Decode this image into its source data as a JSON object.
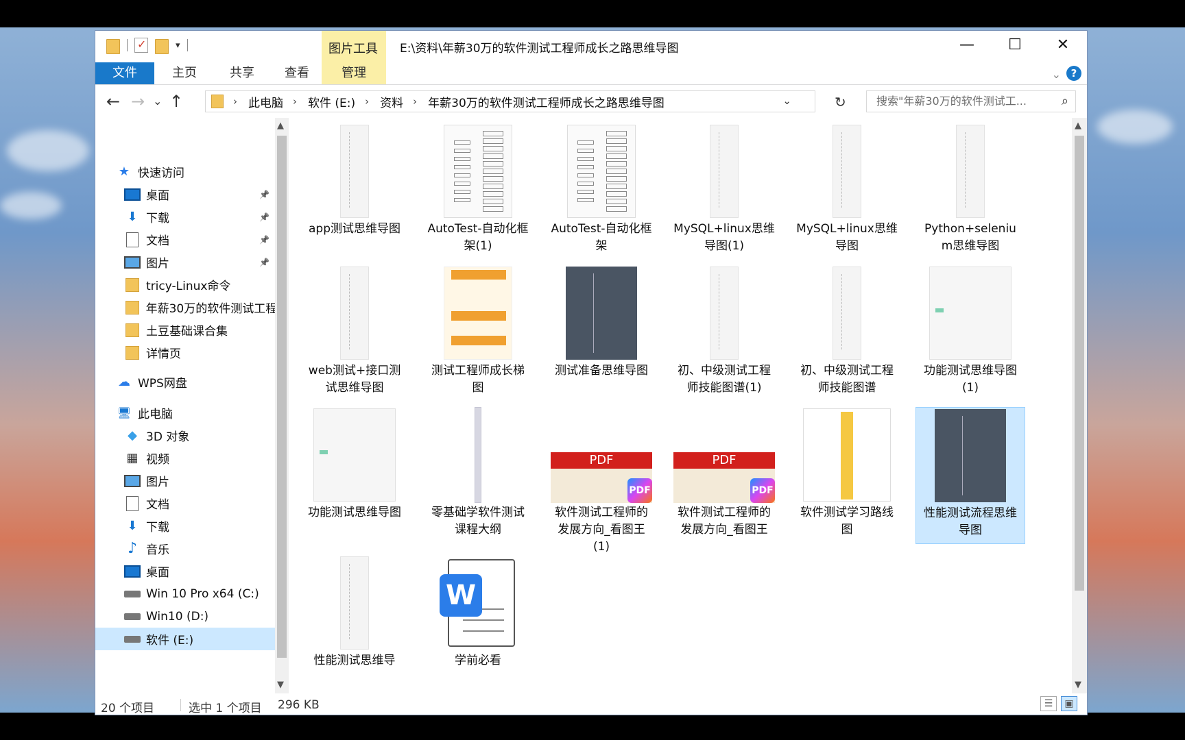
{
  "window": {
    "title": "E:\\资料\\年薪30万的软件测试工程师成长之路思维导图",
    "context_tab_group": "图片工具",
    "controls": {
      "minimize": "—",
      "maximize": "☐",
      "close": "✕"
    }
  },
  "ribbon": {
    "tabs": [
      "文件",
      "主页",
      "共享",
      "查看",
      "管理"
    ],
    "help": "?"
  },
  "nav": {
    "back": "←",
    "forward": "→",
    "recent": "⌄",
    "up": "↑",
    "breadcrumb": [
      "此电脑",
      "软件 (E:)",
      "资料",
      "年薪30万的软件测试工程师成长之路思维导图"
    ],
    "search_placeholder": "搜索\"年薪30万的软件测试工...",
    "refresh": "↻"
  },
  "sidebar": {
    "items": [
      {
        "label": "快速访问",
        "icon": "star-icon",
        "level": 0
      },
      {
        "label": "桌面",
        "icon": "desktop-icon",
        "level": 1,
        "pinned": true
      },
      {
        "label": "下载",
        "icon": "download-icon",
        "level": 1,
        "pinned": true
      },
      {
        "label": "文档",
        "icon": "document-icon",
        "level": 1,
        "pinned": true
      },
      {
        "label": "图片",
        "icon": "pictures-icon",
        "level": 1,
        "pinned": true
      },
      {
        "label": "tricy-Linux命令",
        "icon": "folder-icon",
        "level": 1
      },
      {
        "label": "年薪30万的软件测试工程",
        "icon": "folder-icon",
        "level": 1
      },
      {
        "label": "土豆基础课合集",
        "icon": "folder-icon",
        "level": 1
      },
      {
        "label": "详情页",
        "icon": "folder-icon",
        "level": 1
      },
      {
        "label": "WPS网盘",
        "icon": "cloud-icon",
        "level": 0
      },
      {
        "label": "此电脑",
        "icon": "computer-icon",
        "level": 0
      },
      {
        "label": "3D 对象",
        "icon": "3d-objects-icon",
        "level": 1
      },
      {
        "label": "视频",
        "icon": "video-icon",
        "level": 1
      },
      {
        "label": "图片",
        "icon": "pictures-icon",
        "level": 1
      },
      {
        "label": "文档",
        "icon": "document-icon",
        "level": 1
      },
      {
        "label": "下载",
        "icon": "download-icon",
        "level": 1
      },
      {
        "label": "音乐",
        "icon": "music-icon",
        "level": 1
      },
      {
        "label": "桌面",
        "icon": "desktop-icon",
        "level": 1
      },
      {
        "label": "Win 10 Pro x64 (C:)",
        "icon": "drive-c-icon",
        "level": 1
      },
      {
        "label": "Win10 (D:)",
        "icon": "drive-icon",
        "level": 1
      },
      {
        "label": "软件 (E:)",
        "icon": "drive-icon",
        "level": 1,
        "selected": true
      }
    ]
  },
  "files": [
    {
      "name": "app测试思维导图",
      "thumb": "tall"
    },
    {
      "name": "AutoTest-自动化框架(1)",
      "thumb": "tree"
    },
    {
      "name": "AutoTest-自动化框架",
      "thumb": "tree"
    },
    {
      "name": "MySQL+linux思维导图(1)",
      "thumb": "tall"
    },
    {
      "name": "MySQL+linux思维导图",
      "thumb": "tall"
    },
    {
      "name": "Python+selenium思维导图",
      "thumb": "tall"
    },
    {
      "name": "web测试+接口测试思维导图",
      "thumb": "tall"
    },
    {
      "name": "测试工程师成长梯图",
      "thumb": "ladder"
    },
    {
      "name": "测试准备思维导图",
      "thumb": "dark"
    },
    {
      "name": "初、中级测试工程师技能图谱(1)",
      "thumb": "tall"
    },
    {
      "name": "初、中级测试工程师技能图谱",
      "thumb": "tall"
    },
    {
      "name": "功能测试思维导图(1)",
      "thumb": "wide"
    },
    {
      "name": "功能测试思维导图",
      "thumb": "wide"
    },
    {
      "name": "零基础学软件测试课程大纲",
      "thumb": "thin"
    },
    {
      "name": "软件测试工程师的发展方向_看图王(1)",
      "thumb": "pdf"
    },
    {
      "name": "软件测试工程师的发展方向_看图王",
      "thumb": "pdf"
    },
    {
      "name": "软件测试学习路线图",
      "thumb": "colorful"
    },
    {
      "name": "性能测试流程思维导图",
      "thumb": "dark",
      "selected": true
    },
    {
      "name": "性能测试思维导",
      "thumb": "tall"
    },
    {
      "name": "学前必看",
      "thumb": "word"
    }
  ],
  "pdf_label": "PDF",
  "word_label": "W",
  "status": {
    "count": "20 个项目",
    "selection": "选中 1 个项目",
    "size": "296 KB"
  }
}
